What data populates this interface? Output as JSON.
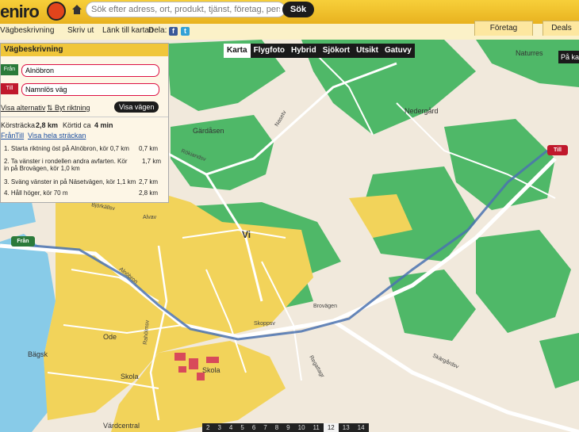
{
  "header": {
    "logo_text": "eniro",
    "search_placeholder": "Sök efter adress, ort, produkt, tjänst, företag, person",
    "search_button": "Sök"
  },
  "menu": {
    "items": [
      "Vägbeskrivning",
      "Skriv ut",
      "Länk till kartan",
      "Dela:"
    ],
    "share_facebook": "f",
    "share_twitter": "t",
    "tab_foretag": "Företag",
    "tab_deals": "Deals"
  },
  "map_types": {
    "tabs": [
      "Karta",
      "Flygfoto",
      "Hybrid",
      "Sjökort",
      "Utsikt",
      "Gatuvy"
    ],
    "active": "Karta",
    "right_label": "På ka"
  },
  "directions": {
    "title": "Vägbeskrivning",
    "from_label": "Från",
    "from_value": "Alnöbron",
    "to_label": "Till",
    "to_value": "Namnlös väg",
    "show_alternatives": "Visa alternativ",
    "swap_direction": "Byt riktning",
    "show_route": "Visa vägen",
    "distance_label": "Körsträcka",
    "distance_value": "2,8 km",
    "time_label": "Körtid ca",
    "time_value": "4 min",
    "link_from": "Från",
    "link_to": "Till",
    "link_whole": "Visa hela sträckan",
    "steps": [
      {
        "text": "1. Starta riktning öst på Alnöbron, kör 0,7 km",
        "dist": "0,7 km"
      },
      {
        "text": "2. Ta vänster i rondellen andra avfarten. Kör in på Brovägen, kör 1,0 km",
        "dist": "1,7 km"
      },
      {
        "text": "3. Sväng vänster in på Näsetvägen, kör 1,1 km",
        "dist": "2,7 km"
      },
      {
        "text": "4. Håll höger, kör 70 m",
        "dist": "2,8 km"
      }
    ]
  },
  "map": {
    "place_labels": [
      "Gärdåsen",
      "Vi",
      "Nedergård",
      "Naturres",
      "Ode",
      "Skola",
      "Skola",
      "Värdcentral",
      "Bägsk"
    ],
    "road_labels": [
      "Rökiandsv",
      "Brovägen",
      "Alnöbron",
      "Skärgårdsv",
      "Rahölmsv",
      "Björkällsv",
      "Nasetv",
      "Regattagr",
      "Alvav",
      "Skoppsv"
    ],
    "marker_from": "Från",
    "marker_to": "Till",
    "colors": {
      "forest": "#4fb868",
      "residential": "#f2d35a",
      "water": "#88cbe8",
      "route": "#4a72b0",
      "base": "#f1e9dc"
    }
  },
  "pager": {
    "pages": [
      "2",
      "3",
      "4",
      "5",
      "6",
      "7",
      "8",
      "9",
      "10",
      "11",
      "12",
      "13",
      "14"
    ],
    "active": "12"
  }
}
